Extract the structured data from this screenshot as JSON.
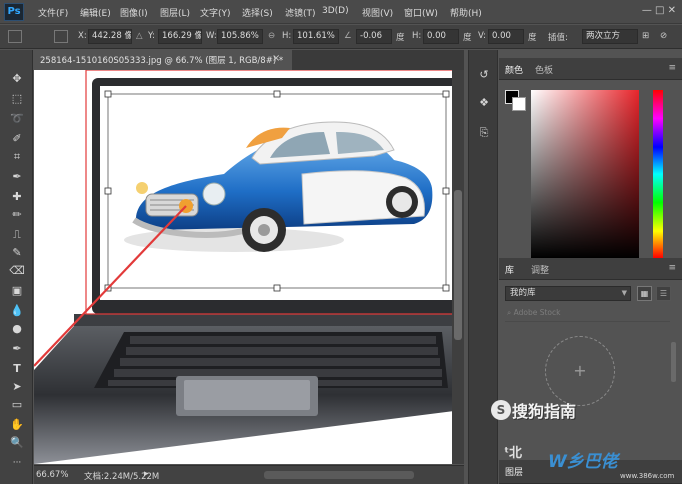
{
  "app": {
    "logo": "Ps",
    "window_controls": "— □ ✕"
  },
  "menu": [
    "文件(F)",
    "编辑(E)",
    "图像(I)",
    "图层(L)",
    "文字(Y)",
    "选择(S)",
    "滤镜(T)",
    "3D(D)",
    "视图(V)",
    "窗口(W)",
    "帮助(H)"
  ],
  "options": {
    "x_label": "X:",
    "x_value": "442.28 像素",
    "y_label": "Y:",
    "y_value": "166.29 像素",
    "w_label": "W:",
    "w_value": "105.86%",
    "h_label": "H:",
    "h_value": "101.61%",
    "angle_value": "-0.06",
    "angle_unit": "度",
    "hskew_label": "H:",
    "hskew_value": "0.00",
    "hskew_unit": "度",
    "vskew_label": "V:",
    "vskew_value": "0.00",
    "vskew_unit": "度",
    "interp_label": "插值:",
    "interp_value": "两次立方"
  },
  "document": {
    "tab_title": "258164-1510160S05333.jpg @ 66.7% (图层 1, RGB/8#) *",
    "close": "×"
  },
  "status": {
    "zoom": "66.67%",
    "doc_size": "文档:2.24M/5.22M",
    "arrow": "▸"
  },
  "panels": {
    "color_tabs": [
      "颜色",
      "色板"
    ],
    "library_tabs": [
      "库",
      "调整"
    ],
    "library_select": "我的库",
    "library_search": "Adobe Stock",
    "library_add": "+",
    "layers_tab": "图层",
    "menu_glyph": "≡"
  },
  "watermark": {
    "sougou": "搜狗指南",
    "s_glyph": "S",
    "site_logo": "W乡巴佬",
    "site_url": "www.386w.com",
    "left_text": "ᵗ北"
  },
  "colors": {
    "bg": "#535353",
    "panel_dark": "#424242",
    "accent": "#31a8ff",
    "foreground_color": "#000000",
    "background_color": "#ffffff"
  }
}
